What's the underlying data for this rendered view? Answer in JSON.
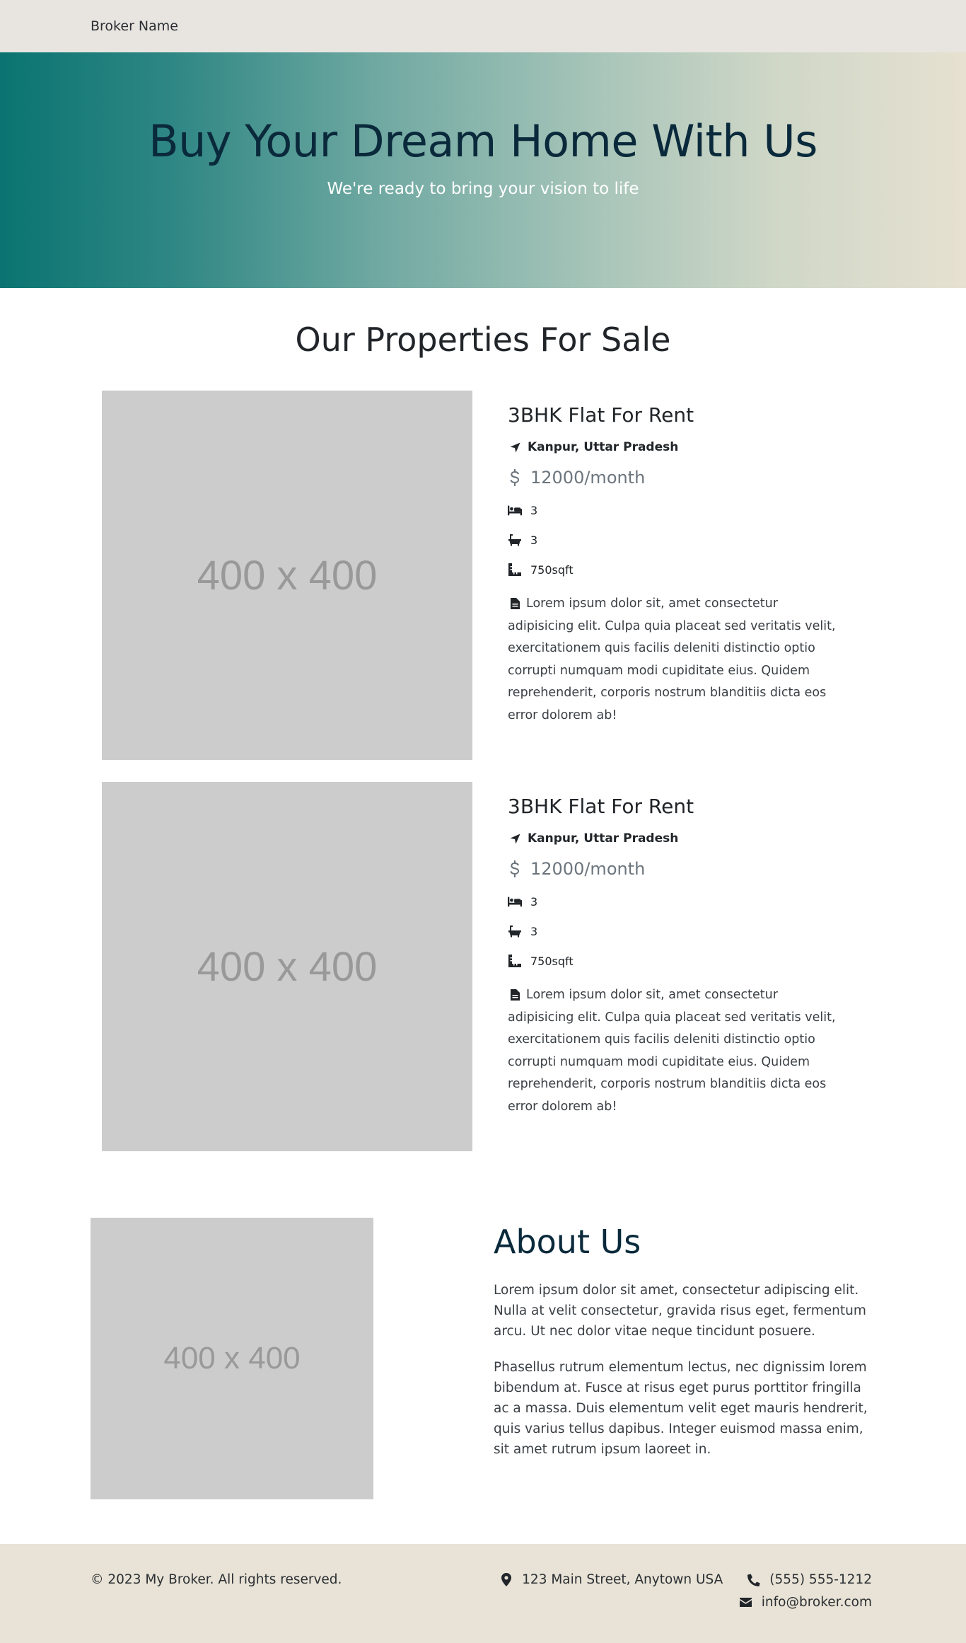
{
  "navbar": {
    "brand": "Broker Name"
  },
  "hero": {
    "title": "Buy Your Dream Home With Us",
    "subtitle": "We're ready to bring your vision to life"
  },
  "properties": {
    "heading": "Our Properties For Sale",
    "items": [
      {
        "image_placeholder": "400 x 400",
        "title": "3BHK Flat For Rent",
        "location": "Kanpur, Uttar Pradesh",
        "price": "12000/month",
        "bedrooms": "3",
        "bathrooms": "3",
        "area": "750sqft",
        "description": "Lorem ipsum dolor sit, amet consectetur adipisicing elit. Culpa quia placeat sed veritatis velit, exercitationem quis facilis deleniti distinctio optio corrupti numquam modi cupiditate eius. Quidem reprehenderit, corporis nostrum blanditiis dicta eos error dolorem ab!"
      },
      {
        "image_placeholder": "400 x 400",
        "title": "3BHK Flat For Rent",
        "location": "Kanpur, Uttar Pradesh",
        "price": "12000/month",
        "bedrooms": "3",
        "bathrooms": "3",
        "area": "750sqft",
        "description": "Lorem ipsum dolor sit, amet consectetur adipisicing elit. Culpa quia placeat sed veritatis velit, exercitationem quis facilis deleniti distinctio optio corrupti numquam modi cupiditate eius. Quidem reprehenderit, corporis nostrum blanditiis dicta eos error dolorem ab!"
      }
    ]
  },
  "about": {
    "image_placeholder": "400 x 400",
    "heading": "About Us",
    "paragraph1": "Lorem ipsum dolor sit amet, consectetur adipiscing elit. Nulla at velit consectetur, gravida risus eget, fermentum arcu. Ut nec dolor vitae neque tincidunt posuere.",
    "paragraph2": "Phasellus rutrum elementum lectus, nec dignissim lorem bibendum at. Fusce at risus eget purus porttitor fringilla ac a massa. Duis elementum velit eget mauris hendrerit, quis varius tellus dapibus. Integer euismod massa enim, sit amet rutrum ipsum laoreet in."
  },
  "footer": {
    "copyright": "© 2023 My Broker. All rights reserved.",
    "address": "123 Main Street, Anytown USA",
    "phone": "(555) 555-1212",
    "email": "info@broker.com"
  },
  "colors": {
    "hero_gradient_start": "#0a7471",
    "hero_gradient_end": "#e6e1d1",
    "heading_dark": "#0a2a3c",
    "navbar_bg": "#e8e5e1",
    "footer_bg": "#e8e3d6",
    "placeholder_bg": "#cccccc"
  },
  "icons": {
    "location": "location-arrow-icon",
    "price": "dollar-icon",
    "bedrooms": "bed-icon",
    "bathrooms": "bath-icon",
    "area": "ruler-icon",
    "description": "file-icon",
    "address": "map-marker-icon",
    "phone": "phone-icon",
    "email": "envelope-icon"
  }
}
